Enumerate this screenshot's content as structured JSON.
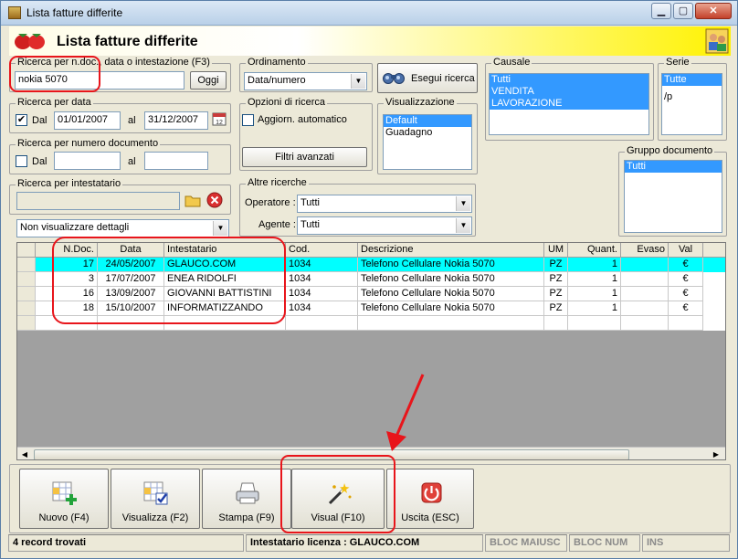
{
  "window": {
    "title": "Lista fatture differite",
    "header_title": "Lista fatture differite"
  },
  "search_doc": {
    "label": "Ricerca per n.doc., data o intestazione (F3)",
    "value": "nokia 5070",
    "today_button": "Oggi"
  },
  "search_date": {
    "label": "Ricerca per data",
    "from_checked": true,
    "from_label": "Dal",
    "from_value": "01/01/2007",
    "to_label": "al",
    "to_value": "31/12/2007"
  },
  "search_number": {
    "label": "Ricerca per numero documento",
    "from_checked": false,
    "from_label": "Dal",
    "from_value": "",
    "to_label": "al",
    "to_value": ""
  },
  "search_holder": {
    "label": "Ricerca per intestatario",
    "value": ""
  },
  "details_combo": {
    "value": "Non visualizzare dettagli"
  },
  "ordering": {
    "label": "Ordinamento",
    "value": "Data/numero"
  },
  "search_options": {
    "label": "Opzioni di ricerca",
    "auto_update_label": "Aggiorn. automatico",
    "auto_update_checked": false,
    "advanced_filters": "Filtri avanzati"
  },
  "execute_search": {
    "label": "Esegui ricerca"
  },
  "view_mode": {
    "label": "Visualizzazione",
    "items": [
      "Default",
      "Guadagno"
    ],
    "selected": 0
  },
  "causale": {
    "label": "Causale",
    "items": [
      "Tutti",
      "VENDITA",
      "LAVORAZIONE"
    ]
  },
  "serie": {
    "label": "Serie",
    "items": [
      "Tutte",
      "/p"
    ],
    "selected": 0
  },
  "document_group": {
    "label": "Gruppo documento",
    "items": [
      "Tutti"
    ],
    "selected": 0
  },
  "other_searches": {
    "label": "Altre ricerche",
    "operator_label": "Operatore :",
    "operator_value": "Tutti",
    "agent_label": "Agente :",
    "agent_value": "Tutti"
  },
  "table": {
    "columns": [
      "N.Doc.",
      "Data",
      "Intestatario",
      "Cod.",
      "Descrizione",
      "UM",
      "Quant.",
      "Evaso",
      "Val"
    ],
    "rows": [
      {
        "ndoc": "17",
        "data": "24/05/2007",
        "intestatario": "GLAUCO.COM",
        "cod": "1034",
        "descrizione": "Telefono Cellulare Nokia 5070",
        "um": "PZ",
        "quant": "1",
        "evaso": "",
        "val": "€"
      },
      {
        "ndoc": "3",
        "data": "17/07/2007",
        "intestatario": "ENEA RIDOLFI",
        "cod": "1034",
        "descrizione": "Telefono Cellulare Nokia 5070",
        "um": "PZ",
        "quant": "1",
        "evaso": "",
        "val": "€"
      },
      {
        "ndoc": "16",
        "data": "13/09/2007",
        "intestatario": "GIOVANNI BATTISTINI",
        "cod": "1034",
        "descrizione": "Telefono Cellulare Nokia 5070",
        "um": "PZ",
        "quant": "1",
        "evaso": "",
        "val": "€"
      },
      {
        "ndoc": "18",
        "data": "15/10/2007",
        "intestatario": "INFORMATIZZANDO",
        "cod": "1034",
        "descrizione": "Telefono Cellulare Nokia 5070",
        "um": "PZ",
        "quant": "1",
        "evaso": "",
        "val": "€"
      }
    ],
    "selected_row": 0
  },
  "toolbar": {
    "new_label": "Nuovo (F4)",
    "view_label": "Visualizza (F2)",
    "print_label": "Stampa (F9)",
    "visual_label": "Visual (F10)",
    "exit_label": "Uscita (ESC)"
  },
  "statusbar": {
    "records": "4 record trovati",
    "license": "Intestatario licenza : GLAUCO.COM",
    "caps": "BLOC MAIUSC",
    "num": "BLOC NUM",
    "ins": "INS"
  },
  "colors": {
    "selected_row": "#00ffff",
    "selection_blue": "#3399ff",
    "annotation_red": "#e8151b",
    "header_yellow": "#fff200"
  }
}
